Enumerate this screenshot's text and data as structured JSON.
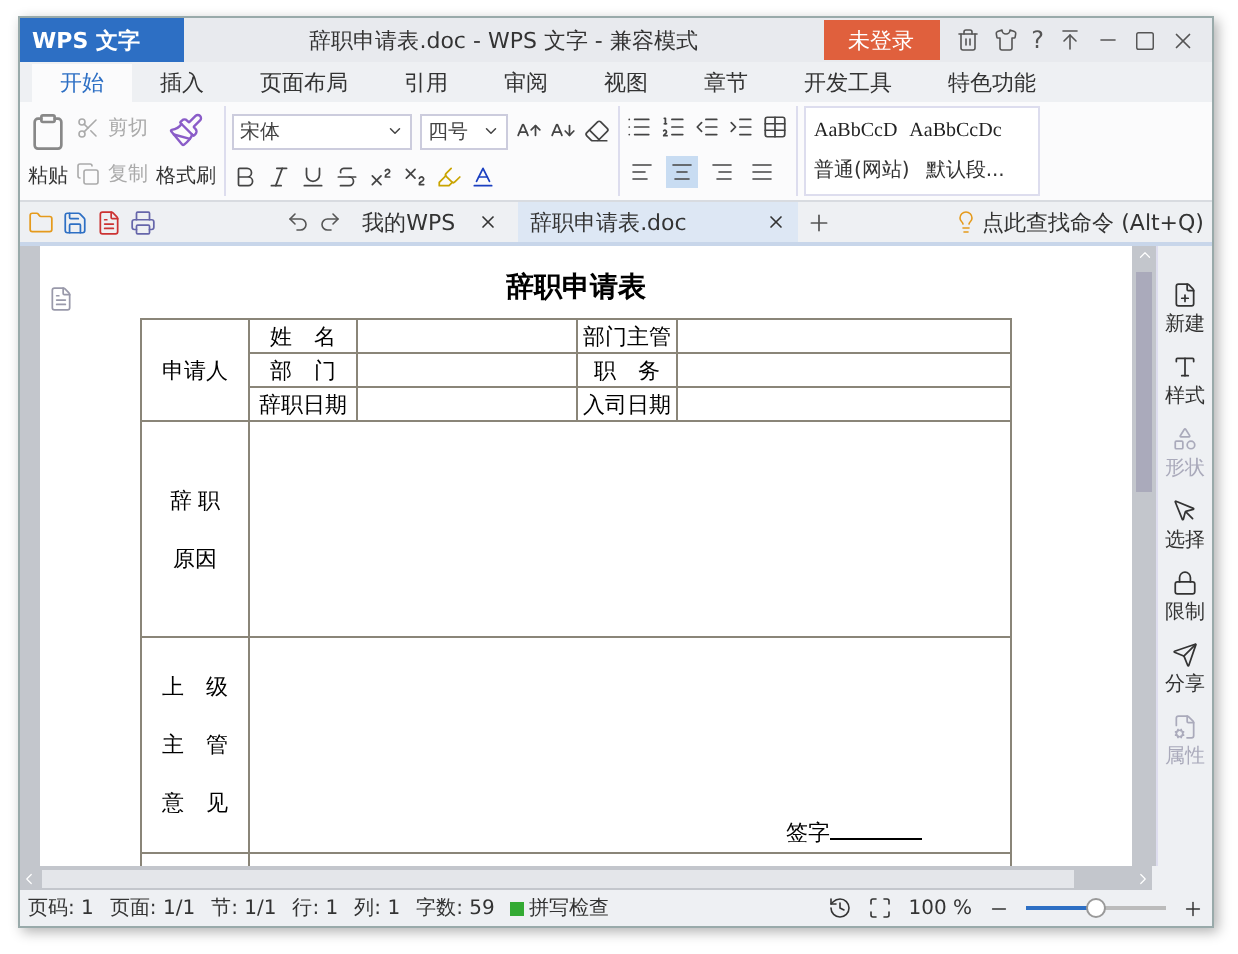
{
  "title_bar": {
    "app_button": "WPS 文字",
    "caption": "辞职申请表.doc - WPS 文字 - 兼容模式",
    "login": "未登录",
    "help": "?"
  },
  "ribbon_tabs": [
    {
      "label": "开始",
      "selected": true
    },
    {
      "label": "插入",
      "selected": false
    },
    {
      "label": "页面布局",
      "selected": false
    },
    {
      "label": "引用",
      "selected": false
    },
    {
      "label": "审阅",
      "selected": false
    },
    {
      "label": "视图",
      "selected": false
    },
    {
      "label": "章节",
      "selected": false
    },
    {
      "label": "开发工具",
      "selected": false
    },
    {
      "label": "特色功能",
      "selected": false
    }
  ],
  "clipboard": {
    "paste": "粘贴",
    "cut": "剪切",
    "copy": "复制",
    "format_painter": "格式刷",
    "cut_disabled": true
  },
  "font": {
    "name": "宋体",
    "size": "四号"
  },
  "alignment": [
    {
      "kind": "left",
      "selected": false
    },
    {
      "kind": "center",
      "selected": true
    },
    {
      "kind": "right",
      "selected": false
    },
    {
      "kind": "justify",
      "selected": false
    }
  ],
  "styles": [
    {
      "preview": "AaBbCcD",
      "label": "普通(网站)"
    },
    {
      "preview": "AaBbCcDc",
      "label": "默认段..."
    }
  ],
  "doc_tabs": [
    {
      "label": "我的WPS",
      "selected": false
    },
    {
      "label": "辞职申请表.doc",
      "selected": true
    }
  ],
  "command_search": "点此查找命令 (Alt+Q)",
  "document": {
    "title": "辞职申请表",
    "applicant_label": "申请人",
    "fields": [
      [
        "姓　名",
        "部门主管"
      ],
      [
        "部　门",
        "职　务"
      ],
      [
        "辞职日期",
        "入司日期"
      ]
    ],
    "reason_label": [
      "辞 职",
      "原因"
    ],
    "supervisor_label": [
      "上　级",
      "主　管",
      "意　见"
    ],
    "signature": "签字"
  },
  "side_panel": [
    {
      "kind": "new",
      "label": "新建",
      "disabled": false
    },
    {
      "kind": "style",
      "label": "样式",
      "disabled": false
    },
    {
      "kind": "shape",
      "label": "形状",
      "disabled": true
    },
    {
      "kind": "select",
      "label": "选择",
      "disabled": false
    },
    {
      "kind": "limit",
      "label": "限制",
      "disabled": false
    },
    {
      "kind": "share",
      "label": "分享",
      "disabled": false
    },
    {
      "kind": "props",
      "label": "属性",
      "disabled": true
    }
  ],
  "status_bar": {
    "items": [
      "页码: 1",
      "页面: 1/1",
      "节: 1/1",
      "行: 1",
      "列: 1",
      "字数: 59"
    ],
    "spell_check": "拼写检查",
    "zoom": "100 %",
    "zoom_slider": {
      "level": 0.5
    }
  }
}
